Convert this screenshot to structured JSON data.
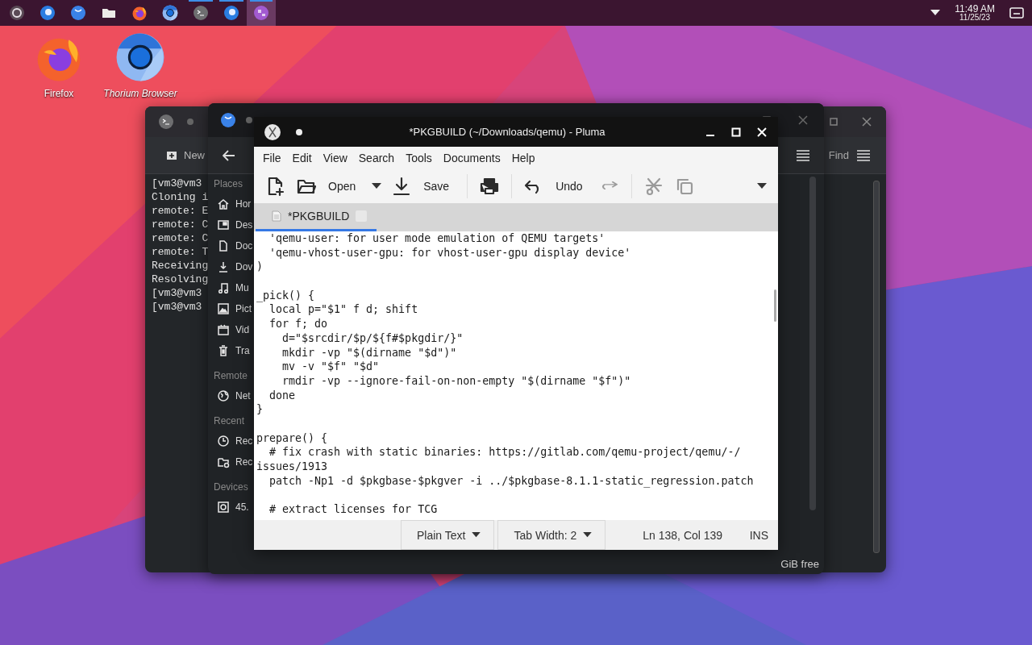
{
  "taskbar": {
    "items": [
      {
        "kind": "ring",
        "running": false,
        "selected": false
      },
      {
        "kind": "blue-dot",
        "running": false,
        "selected": false
      },
      {
        "kind": "blue-arc",
        "running": false,
        "selected": false
      },
      {
        "kind": "folder",
        "running": false,
        "selected": false
      },
      {
        "kind": "firefox",
        "running": false,
        "selected": false
      },
      {
        "kind": "chromium",
        "running": false,
        "selected": false
      },
      {
        "kind": "terminal",
        "running": true,
        "selected": false
      },
      {
        "kind": "blue-dot",
        "running": true,
        "selected": false
      },
      {
        "kind": "purple",
        "running": true,
        "selected": true
      }
    ],
    "clock": {
      "time": "11:49 AM",
      "date": "11/25/23"
    }
  },
  "desktop_icons": [
    {
      "kind": "firefox",
      "label": "Firefox"
    },
    {
      "kind": "chromium",
      "label": "Thorium Browser"
    }
  ],
  "terminal": {
    "toolbar_button": "New",
    "find": "Find",
    "lines": [
      "[vm3@vm3",
      "Cloning i",
      "remote: E",
      "remote: C",
      "remote: C",
      "remote: T",
      "Receiving",
      "Resolving",
      "[vm3@vm3",
      "[vm3@vm3"
    ]
  },
  "file_manager": {
    "sections": [
      {
        "heading": "Places",
        "items": [
          {
            "kind": "home",
            "label": "Hor"
          },
          {
            "kind": "desktop",
            "label": "Des"
          },
          {
            "kind": "document",
            "label": "Doc"
          },
          {
            "kind": "download",
            "label": "Dov"
          },
          {
            "kind": "music",
            "label": "Mu"
          },
          {
            "kind": "picture",
            "label": "Pict"
          },
          {
            "kind": "video",
            "label": "Vid"
          },
          {
            "kind": "trash",
            "label": "Tra"
          }
        ]
      },
      {
        "heading": "Remote",
        "items": [
          {
            "kind": "network",
            "label": "Net"
          }
        ]
      },
      {
        "heading": "Recent",
        "items": [
          {
            "kind": "clock",
            "label": "Rec"
          },
          {
            "kind": "folder-clock",
            "label": "Rec"
          }
        ]
      },
      {
        "heading": "Devices",
        "items": [
          {
            "kind": "drive",
            "label": "45."
          }
        ]
      }
    ],
    "free_space": "GiB free"
  },
  "editor": {
    "window_title": "*PKGBUILD (~/Downloads/qemu) - Pluma",
    "menu": [
      "File",
      "Edit",
      "View",
      "Search",
      "Tools",
      "Documents",
      "Help"
    ],
    "toolbar": [
      [
        {
          "kind": "new",
          "disabled": false
        },
        {
          "kind": "open",
          "label": "Open",
          "disabled": false
        },
        {
          "kind": "dropdown",
          "disabled": false
        },
        {
          "kind": "save",
          "label": "Save",
          "disabled": false
        }
      ],
      [
        {
          "kind": "print",
          "disabled": false
        }
      ],
      [
        {
          "kind": "undo",
          "label": "Undo",
          "disabled": false
        },
        {
          "kind": "redo",
          "disabled": true
        }
      ],
      [
        {
          "kind": "cut",
          "disabled": true
        },
        {
          "kind": "copy",
          "disabled": true
        }
      ]
    ],
    "tabs": [
      {
        "label": "*PKGBUILD",
        "selected": true
      }
    ],
    "lines": [
      {
        "kind": "code",
        "text": "  'qemu-user: for user mode emulation of QEMU targets'"
      },
      {
        "kind": "code",
        "text": "  'qemu-vhost-user-gpu: for vhost-user-gpu display device'"
      },
      {
        "kind": "code",
        "text": ")"
      },
      {
        "kind": "blank"
      },
      {
        "kind": "code",
        "text": "_pick() {"
      },
      {
        "kind": "code",
        "text": "  local p=\"$1\" f d; shift"
      },
      {
        "kind": "code",
        "text": "  for f; do"
      },
      {
        "kind": "code",
        "text": "    d=\"$srcdir/$p/${f#$pkgdir/}\""
      },
      {
        "kind": "code",
        "text": "    mkdir -vp \"$(dirname \"$d\")\""
      },
      {
        "kind": "code",
        "text": "    mv -v \"$f\" \"$d\""
      },
      {
        "kind": "code",
        "text": "    rmdir -vp --ignore-fail-on-non-empty \"$(dirname \"$f\")\""
      },
      {
        "kind": "code",
        "text": "  done"
      },
      {
        "kind": "code",
        "text": "}"
      },
      {
        "kind": "blank"
      },
      {
        "kind": "code",
        "text": "prepare() {"
      },
      {
        "kind": "code",
        "text": "  # fix crash with static binaries: https://gitlab.com/qemu-project/qemu/-/"
      },
      {
        "kind": "code",
        "text": "issues/1913"
      },
      {
        "kind": "code",
        "text": "  patch -Np1 -d $pkgbase-$pkgver -i ../$pkgbase-8.1.1-static_regression.patch"
      },
      {
        "kind": "blank"
      },
      {
        "kind": "code",
        "text": "  # extract licenses for TCG"
      }
    ],
    "status": {
      "language": "Plain Text",
      "tab_width": "Tab Width: 2",
      "position": "Ln 138, Col 139",
      "mode": "INS"
    }
  }
}
